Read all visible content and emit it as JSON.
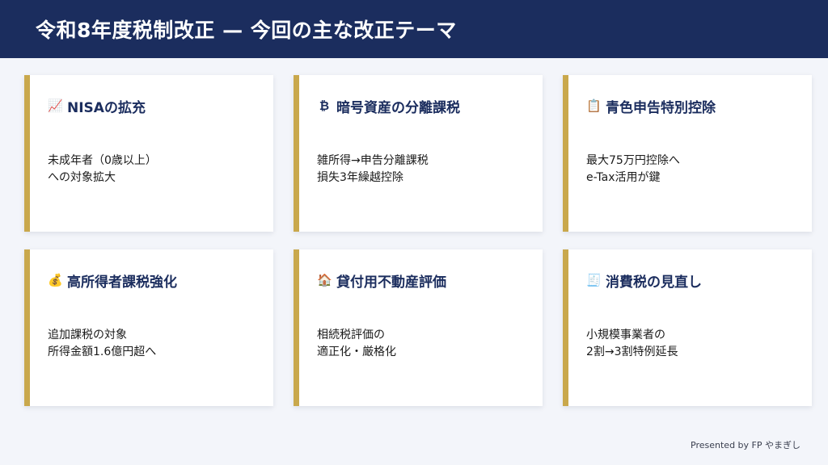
{
  "header": {
    "title": "令和8年度税制改正 — 今回の主な改正テーマ"
  },
  "cards": [
    {
      "icon": "chart-up-icon",
      "glyph": "📈",
      "title": "NISAの拡充",
      "lines": [
        "未成年者（0歳以上）",
        "への対象拡大"
      ]
    },
    {
      "icon": "bitcoin-icon",
      "glyph": "₿",
      "title": "暗号資産の分離課税",
      "lines": [
        "雑所得→申告分離課税",
        "損失3年繰越控除"
      ]
    },
    {
      "icon": "clipboard-icon",
      "glyph": "📋",
      "title": "青色申告特別控除",
      "lines": [
        "最大75万円控除へ",
        "e-Tax活用が鍵"
      ]
    },
    {
      "icon": "money-bag-icon",
      "glyph": "💰",
      "title": "高所得者課税強化",
      "lines": [
        "追加課税の対象",
        "所得金額1.6億円超へ"
      ]
    },
    {
      "icon": "house-icon",
      "glyph": "🏠",
      "title": "貸付用不動産評価",
      "lines": [
        "相続税評価の",
        "適正化・厳格化"
      ]
    },
    {
      "icon": "receipt-icon",
      "glyph": "🧾",
      "title": "消費税の見直し",
      "lines": [
        "小規模事業者の",
        "2割→3割特例延長"
      ]
    }
  ],
  "footer": {
    "text": "Presented by FP やまぎし"
  },
  "colors": {
    "header_bg": "#1b2d5e",
    "accent": "#c9a84c",
    "title_text": "#1b2d5e",
    "page_bg": "#f3f5fa"
  }
}
